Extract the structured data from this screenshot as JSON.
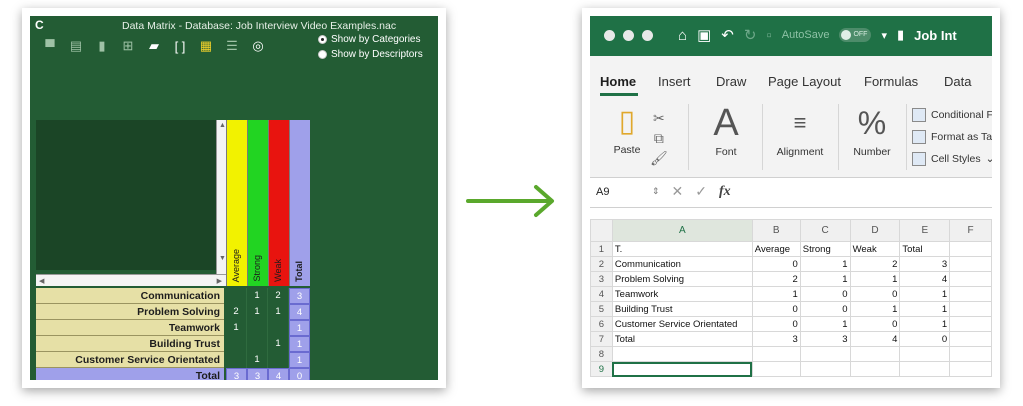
{
  "left": {
    "app_letter": "C",
    "title": "Data Matrix - Database: Job Interview Video Examples.nac",
    "toolbar_icons": [
      "presentation-icon",
      "clapperboard-icon",
      "trash-icon",
      "table-icon",
      "folder-icon",
      "bracket-code-icon",
      "grid-icon",
      "sliders-icon",
      "venn-icon"
    ],
    "radio_options": [
      {
        "label": "Show by Categories",
        "selected": true
      },
      {
        "label": "Show by Descriptors",
        "selected": false
      }
    ],
    "columns": [
      {
        "label": "Average",
        "color": "#f2f200"
      },
      {
        "label": "Strong",
        "color": "#22d422"
      },
      {
        "label": "Weak",
        "color": "#e8140f"
      },
      {
        "label": "Total",
        "color": "#9fa0ea"
      }
    ],
    "rows": [
      {
        "label": "Communication",
        "values": [
          "",
          "1",
          "2"
        ],
        "total": "3"
      },
      {
        "label": "Problem Solving",
        "values": [
          "2",
          "1",
          "1"
        ],
        "total": "4"
      },
      {
        "label": "Teamwork",
        "values": [
          "1",
          "",
          ""
        ],
        "total": "1"
      },
      {
        "label": "Building Trust",
        "values": [
          "",
          "",
          "1"
        ],
        "total": "1"
      },
      {
        "label": "Customer Service Orientated",
        "values": [
          "",
          "1",
          ""
        ],
        "total": "1"
      }
    ],
    "total_row": {
      "label": "Total",
      "values": [
        "3",
        "3",
        "4"
      ],
      "total": "0"
    }
  },
  "right": {
    "title_bar": {
      "autosave_label": "AutoSave",
      "toggle_label": "OFF",
      "doc_title": "Job Int"
    },
    "tabs": [
      "Home",
      "Insert",
      "Draw",
      "Page Layout",
      "Formulas",
      "Data"
    ],
    "active_tab": "Home",
    "ribbon": {
      "paste": "Paste",
      "font": "Font",
      "alignment": "Alignment",
      "number": "Number",
      "font_glyph": "A",
      "number_glyph": "%",
      "side_items": [
        "Conditional Fo",
        "Format as Tab",
        "Cell Styles"
      ]
    },
    "formula_bar": {
      "name_box": "A9",
      "fx": "fx",
      "cancel": "✕",
      "enter": "✓"
    },
    "col_headers": [
      "A",
      "B",
      "C",
      "D",
      "E",
      "F"
    ],
    "grid_rows": [
      {
        "num": "1",
        "cells": [
          "T.",
          "Average",
          "Strong",
          "Weak",
          "Total",
          ""
        ]
      },
      {
        "num": "2",
        "cells": [
          "Communication",
          "0",
          "1",
          "2",
          "3",
          ""
        ]
      },
      {
        "num": "3",
        "cells": [
          "Problem Solving",
          "2",
          "1",
          "1",
          "4",
          ""
        ]
      },
      {
        "num": "4",
        "cells": [
          "Teamwork",
          "1",
          "0",
          "0",
          "1",
          ""
        ]
      },
      {
        "num": "5",
        "cells": [
          "Building Trust",
          "0",
          "0",
          "1",
          "1",
          ""
        ]
      },
      {
        "num": "6",
        "cells": [
          "Customer Service Orientated",
          "0",
          "1",
          "0",
          "1",
          ""
        ]
      },
      {
        "num": "7",
        "cells": [
          "Total",
          "3",
          "3",
          "4",
          "0",
          ""
        ]
      },
      {
        "num": "8",
        "cells": [
          "",
          "",
          "",
          "",
          "",
          ""
        ]
      },
      {
        "num": "9",
        "cells": [
          "",
          "",
          "",
          "",
          "",
          ""
        ]
      }
    ]
  }
}
